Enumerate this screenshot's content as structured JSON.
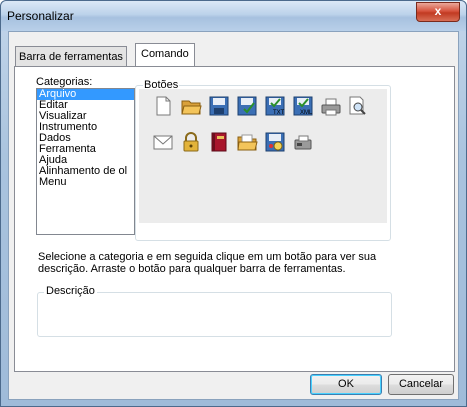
{
  "window": {
    "title": "Personalizar",
    "close_label": "x"
  },
  "tabs": [
    {
      "label": "Barra de ferramentas"
    },
    {
      "label": "Comando"
    }
  ],
  "categories": {
    "label": "Categorias:",
    "items": [
      "Arquivo",
      "Editar",
      "Visualizar",
      "Instrumento",
      "Dados",
      "Ferramenta",
      "Ajuda",
      "Alinhamento de ol",
      "Menu"
    ],
    "selected": "Arquivo"
  },
  "buttons_group": {
    "label": "Botões",
    "icons_row1": [
      "new-document-icon",
      "open-folder-icon",
      "save-icon",
      "save-as-icon",
      "save-txt-icon",
      "save-xml-icon",
      "print-icon",
      "print-preview-icon"
    ],
    "icons_row2": [
      "email-icon",
      "lock-icon",
      "book-icon",
      "folder-open-icon",
      "settings-save-icon",
      "fax-icon"
    ]
  },
  "info_text": "Selecione a categoria e em seguida clique em um botão para ver sua descrição. Arraste o botão para qualquer barra de ferramentas.",
  "description": {
    "label": "Descrição",
    "value": ""
  },
  "footer": {
    "ok_label": "OK",
    "cancel_label": "Cancelar"
  }
}
